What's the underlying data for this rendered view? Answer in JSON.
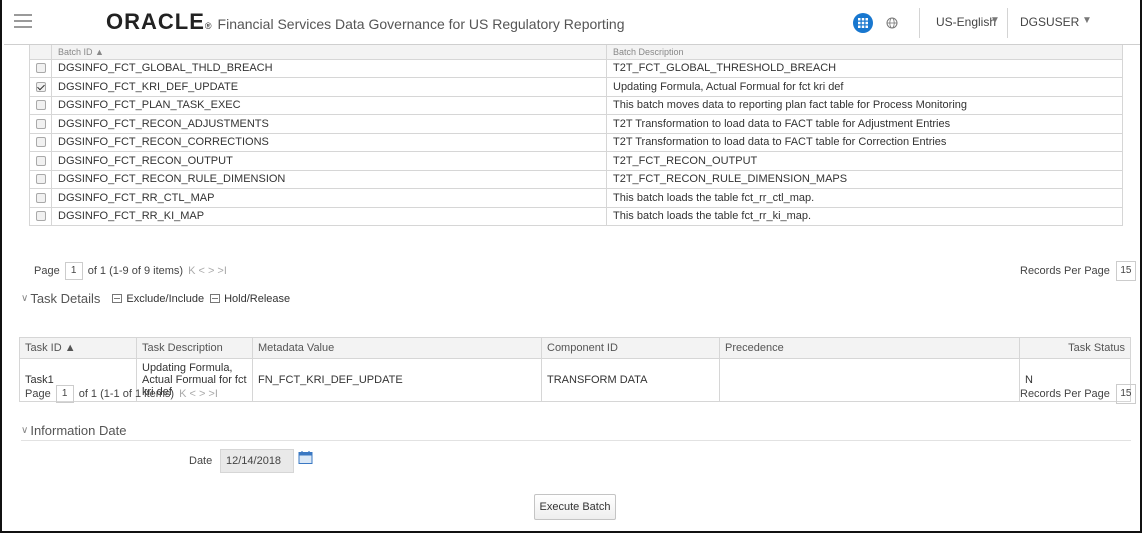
{
  "header": {
    "logo_text": "ORACLE",
    "logo_mark": "®",
    "app_title": "Financial Services Data Governance for US Regulatory Reporting",
    "language": "US-English",
    "user": "DGSUSER",
    "brand_color": "#1877cf"
  },
  "batch_table": {
    "columns": [
      "Batch ID ▲",
      "Batch Description"
    ],
    "rows": [
      {
        "checked": false,
        "id": "DGSINFO_FCT_GLOBAL_THLD_BREACH",
        "description": "T2T_FCT_GLOBAL_THRESHOLD_BREACH"
      },
      {
        "checked": true,
        "id": "DGSINFO_FCT_KRI_DEF_UPDATE",
        "description": "Updating Formula, Actual Formual for fct kri def"
      },
      {
        "checked": false,
        "id": "DGSINFO_FCT_PLAN_TASK_EXEC",
        "description": "This batch moves data to reporting plan fact table for Process Monitoring"
      },
      {
        "checked": false,
        "id": "DGSINFO_FCT_RECON_ADJUSTMENTS",
        "description": "T2T Transformation to load data to FACT table for Adjustment Entries"
      },
      {
        "checked": false,
        "id": "DGSINFO_FCT_RECON_CORRECTIONS",
        "description": "T2T Transformation to load data to FACT table for Correction Entries"
      },
      {
        "checked": false,
        "id": "DGSINFO_FCT_RECON_OUTPUT",
        "description": "T2T_FCT_RECON_OUTPUT"
      },
      {
        "checked": false,
        "id": "DGSINFO_FCT_RECON_RULE_DIMENSION",
        "description": "T2T_FCT_RECON_RULE_DIMENSION_MAPS"
      },
      {
        "checked": false,
        "id": "DGSINFO_FCT_RR_CTL_MAP",
        "description": "This batch loads the table fct_rr_ctl_map."
      },
      {
        "checked": false,
        "id": "DGSINFO_FCT_RR_KI_MAP",
        "description": "This batch loads the table fct_rr_ki_map."
      }
    ],
    "pager": {
      "page_label": "Page",
      "page": "1",
      "info": "of 1 (1-9 of 9 items)",
      "nav": "K  <  >  >I"
    },
    "records_label": "Records Per Page",
    "records_value": "15"
  },
  "task_details": {
    "title": "Task Details",
    "exclude_label": "Exclude/Include",
    "hold_label": "Hold/Release",
    "columns": [
      "Task ID ▲",
      "Task Description",
      "Metadata Value",
      "Component ID",
      "Precedence",
      "Task Status"
    ],
    "rows": [
      {
        "task_id": "Task1",
        "description": "Updating Formula, Actual Formual for fct kri def",
        "metadata": "FN_FCT_KRI_DEF_UPDATE",
        "component": "TRANSFORM DATA",
        "precedence": "",
        "status": "N"
      }
    ],
    "pager": {
      "page_label": "Page",
      "page": "1",
      "info": "of 1 (1-1 of 1 items)",
      "nav": "K  <  >  >I"
    },
    "records_label": "Records Per Page",
    "records_value": "15"
  },
  "information_date": {
    "title": "Information Date",
    "date_label": "Date",
    "date_value": "12/14/2018"
  },
  "actions": {
    "execute_label": "Execute Batch"
  }
}
